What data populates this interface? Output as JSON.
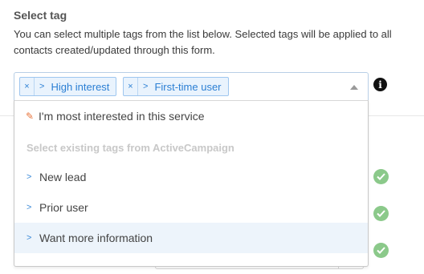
{
  "section": {
    "title": "Select tag",
    "description": "You can select multiple tags from the list below. Selected tags will be applied to all contacts created/updated through this form."
  },
  "select": {
    "selected_tags": [
      {
        "label": "High interest",
        "remove_icon": "×",
        "tag_icon": ">"
      },
      {
        "label": "First-time user",
        "remove_icon": "×",
        "tag_icon": ">"
      }
    ]
  },
  "dropdown": {
    "create_option": {
      "label": "I'm most interested in this service",
      "icon": "pencil-icon"
    },
    "group_label": "Select existing tags from ActiveCampaign",
    "options": [
      {
        "label": "New lead",
        "highlighted": false
      },
      {
        "label": "Prior user",
        "highlighted": false
      },
      {
        "label": "Want more information",
        "highlighted": true
      }
    ]
  },
  "colors": {
    "accent": "#2b7fd4",
    "chip_bg": "#e9f3fd",
    "highlight_bg": "#edf4fb",
    "check_green": "#8bc98a"
  }
}
